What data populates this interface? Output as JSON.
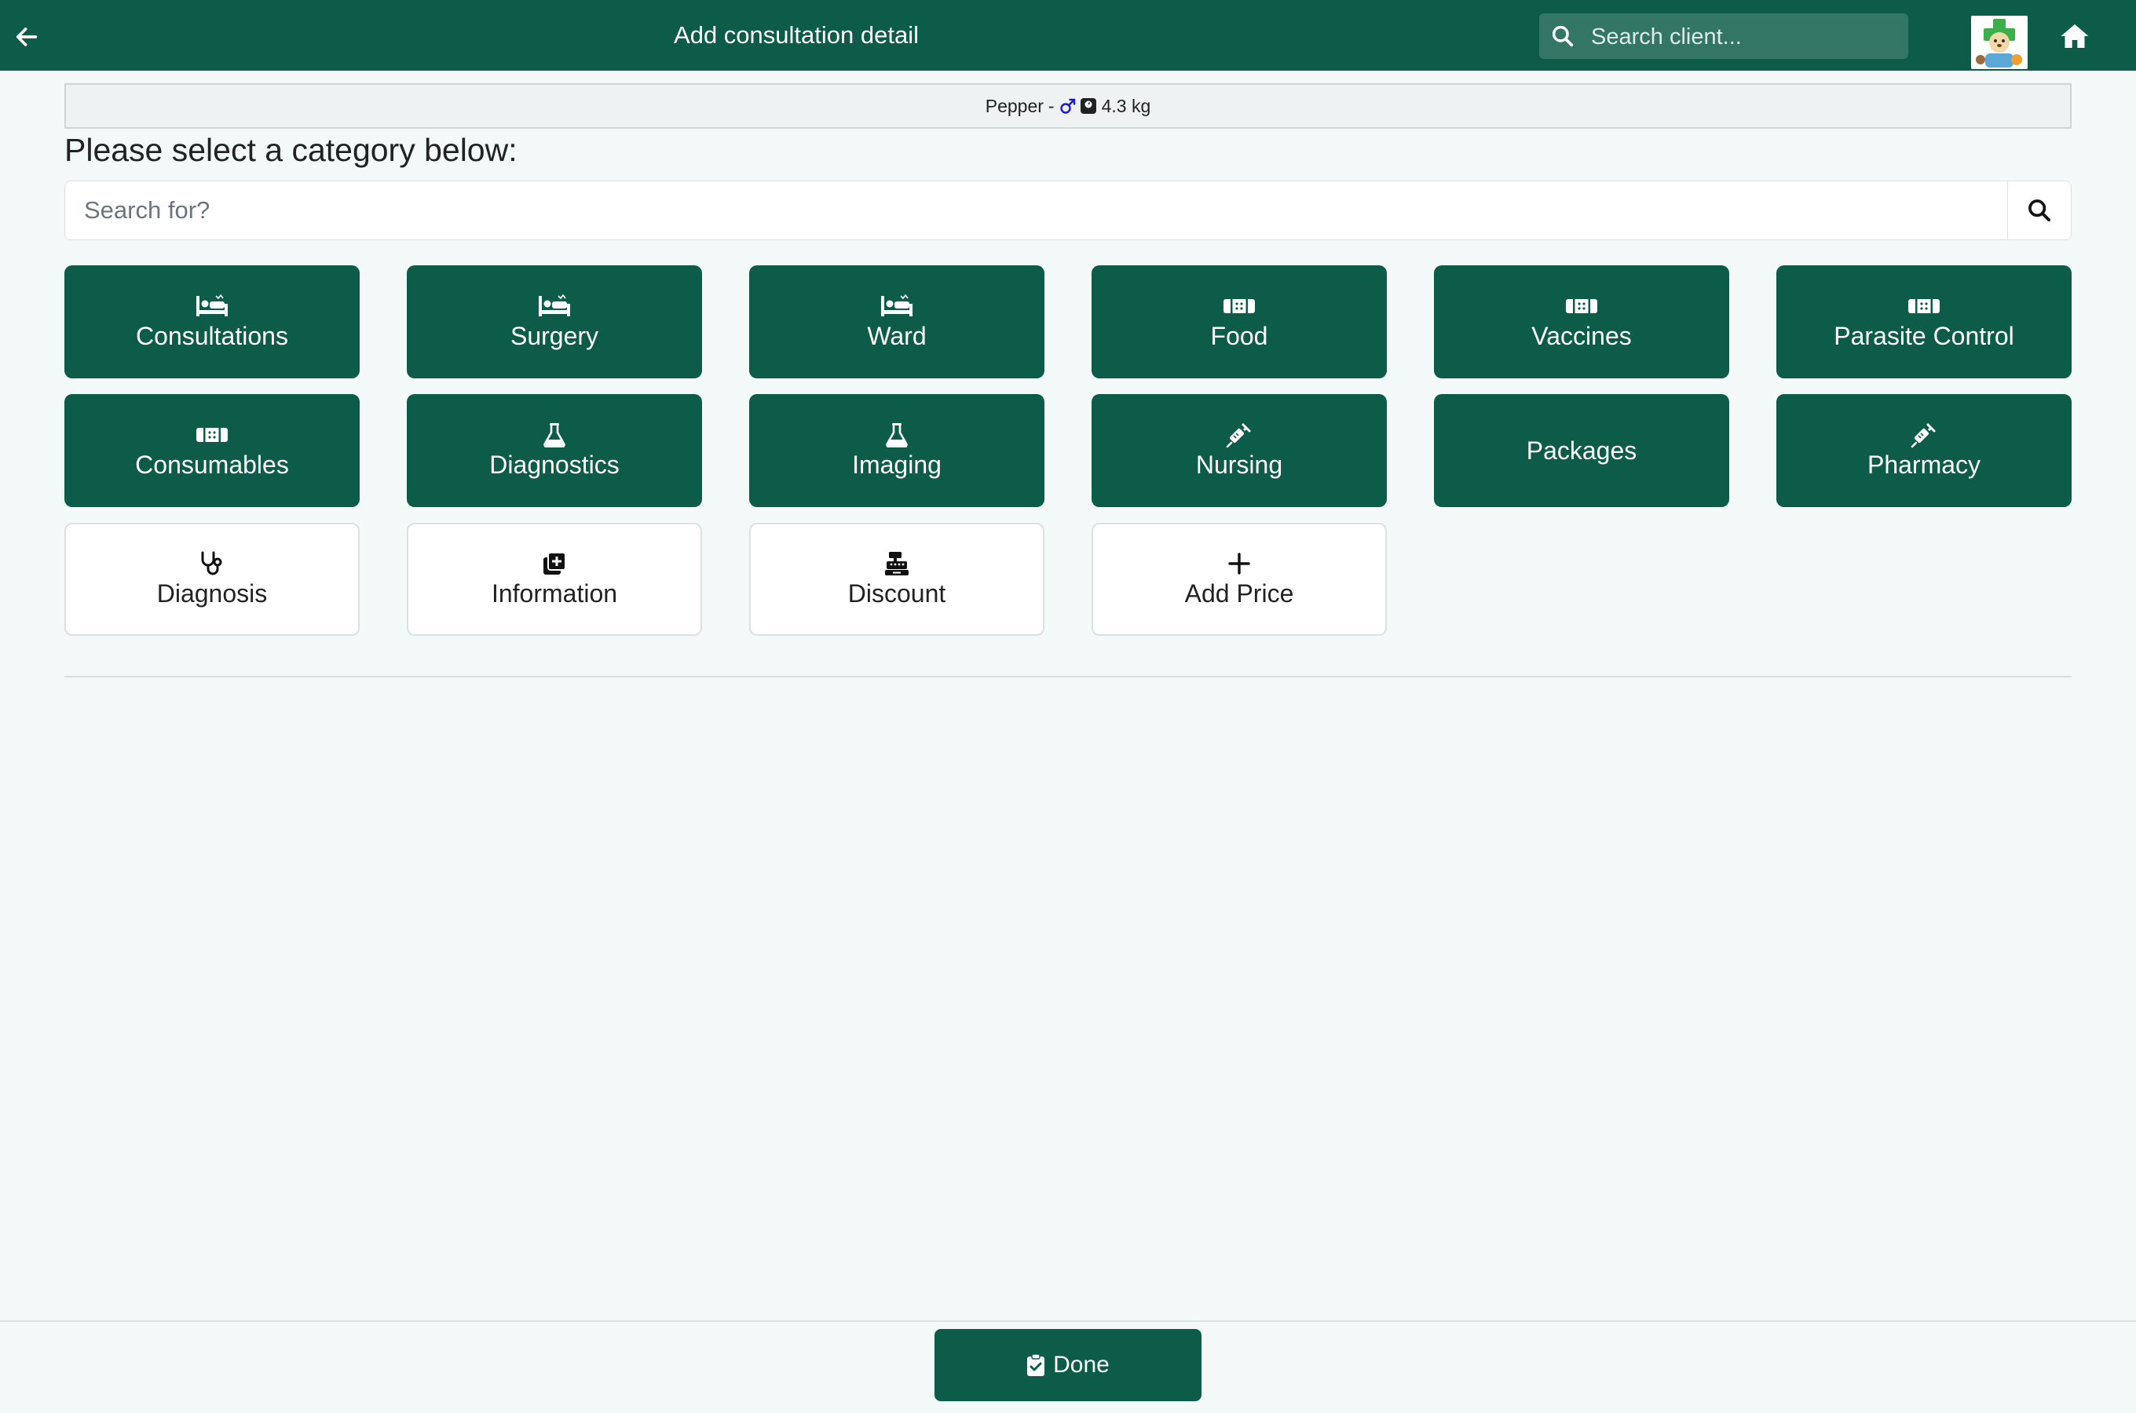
{
  "header": {
    "title": "Add consultation detail",
    "search_placeholder": "Search client...",
    "back_icon": "arrow-left-icon",
    "home_icon": "home-icon",
    "avatar": "clinic-logo",
    "color": "#0d5c49"
  },
  "patient": {
    "name": "Pepper",
    "separator": "-",
    "gender_icon": "male-icon",
    "weight_icon": "weight-scale-icon",
    "weight": "4.3 kg"
  },
  "main": {
    "heading": "Please select a category below:",
    "search_placeholder": "Search for?",
    "search_icon": "search-icon"
  },
  "categories": [
    {
      "label": "Consultations",
      "icon": "bed-icon",
      "style": "green"
    },
    {
      "label": "Surgery",
      "icon": "bed-icon",
      "style": "green"
    },
    {
      "label": "Ward",
      "icon": "bed-icon",
      "style": "green"
    },
    {
      "label": "Food",
      "icon": "bandage-icon",
      "style": "green"
    },
    {
      "label": "Vaccines",
      "icon": "bandage-icon",
      "style": "green"
    },
    {
      "label": "Parasite Control",
      "icon": "bandage-icon",
      "style": "green"
    },
    {
      "label": "Consumables",
      "icon": "bandage-icon",
      "style": "green"
    },
    {
      "label": "Diagnostics",
      "icon": "flask-icon",
      "style": "green"
    },
    {
      "label": "Imaging",
      "icon": "flask-icon",
      "style": "green"
    },
    {
      "label": "Nursing",
      "icon": "syringe-icon",
      "style": "green"
    },
    {
      "label": "Packages",
      "icon": "",
      "style": "green"
    },
    {
      "label": "Pharmacy",
      "icon": "syringe-icon",
      "style": "green"
    },
    {
      "label": "Diagnosis",
      "icon": "stethoscope-icon",
      "style": "white"
    },
    {
      "label": "Information",
      "icon": "notes-medical-icon",
      "style": "white"
    },
    {
      "label": "Discount",
      "icon": "cash-register-icon",
      "style": "white"
    },
    {
      "label": "Add Price",
      "icon": "plus-icon",
      "style": "white"
    }
  ],
  "footer": {
    "done_label": "Done",
    "done_icon": "clipboard-check-icon"
  }
}
